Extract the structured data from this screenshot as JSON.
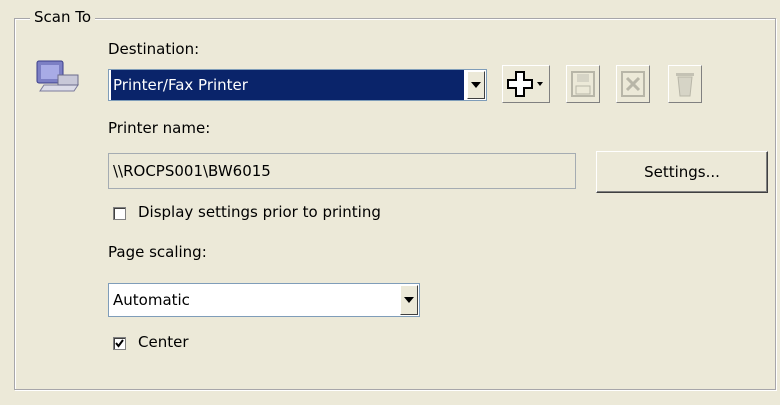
{
  "scan_to": {
    "group_title": "Scan To",
    "destination_label": "Destination:",
    "destination_value": "Printer/Fax Printer",
    "printer_name_label": "Printer name:",
    "printer_name_value": "\\\\ROCPS001\\BW6015",
    "settings_button": "Settings...",
    "display_settings_label": "Display settings prior to printing",
    "display_settings_checked": false,
    "page_scaling_label": "Page scaling:",
    "page_scaling_value": "Automatic",
    "center_label": "Center",
    "center_checked": true
  },
  "toolbar": {
    "icons": [
      "add-icon",
      "save-icon",
      "delete-icon",
      "trash-icon"
    ]
  },
  "colors": {
    "background": "#ece9d8",
    "selection": "#0a246a"
  }
}
